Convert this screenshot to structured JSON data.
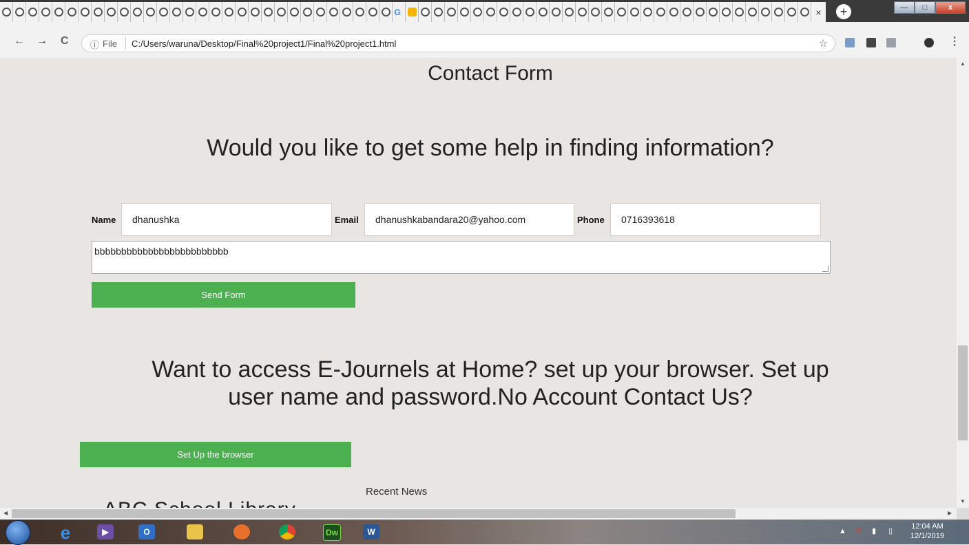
{
  "browser": {
    "tab_close": "×",
    "new_tab": "+",
    "window_controls": {
      "minimize": "—",
      "maximize": "□",
      "close": "x"
    },
    "nav": {
      "back": "←",
      "forward": "→",
      "reload": "C"
    },
    "omnibox": {
      "info": "ⓘ",
      "scheme": "File",
      "url": "C:/Users/waruna/Desktop/Final%20project1/Final%20project1.html",
      "star": "☆"
    }
  },
  "page": {
    "contact_heading": "Contact Form",
    "help_heading": "Would you like to get some help in finding information?",
    "form": {
      "name_label": "Name",
      "name_value": "dhanushka",
      "email_label": "Email",
      "email_value": "dhanushkabandara20@yahoo.com",
      "phone_label": "Phone",
      "phone_value": "0716393618",
      "message_value": "bbbbbbbbbbbbbbbbbbbbbbbbb",
      "send_button": "Send Form"
    },
    "journals_heading_line1": "Want to access E-Journels at Home? set up your browser. Set up",
    "journals_heading_line2": "user name and password.No Account Contact Us?",
    "setup_button": "Set Up the browser",
    "recent_news": "Recent News",
    "partial_heading": "ABC School Library"
  },
  "taskbar": {
    "dreamweaver": "Dw",
    "word": "W",
    "clock_time": "12:04 AM",
    "clock_date": "12/1/2019"
  },
  "colors": {
    "accent_green": "#4caf50",
    "page_bg": "#e8e5e3"
  }
}
